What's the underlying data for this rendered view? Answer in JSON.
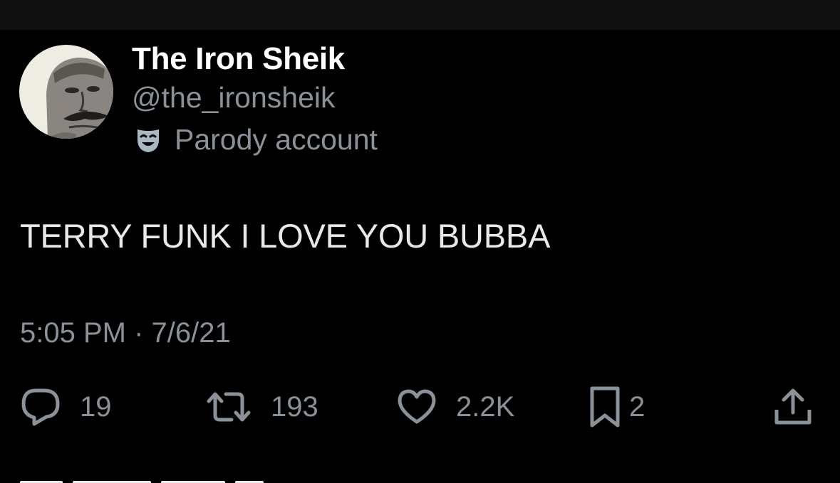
{
  "tweet": {
    "author": {
      "display_name": "The Iron Sheik",
      "handle": "@the_ironsheik",
      "label": "Parody account",
      "label_icon": "theater-mask-icon"
    },
    "text": "TERRY FUNK I LOVE YOU BUBBA",
    "timestamp": "5:05 PM · 7/6/21",
    "actions": {
      "replies": "19",
      "reposts": "193",
      "likes": "2.2K",
      "bookmarks": "2",
      "reply_icon": "reply-icon",
      "repost_icon": "repost-icon",
      "like_icon": "heart-icon",
      "bookmark_icon": "bookmark-icon",
      "share_icon": "share-icon"
    }
  },
  "colors": {
    "background": "#000000",
    "top_bar": "#0f0f10",
    "primary_text": "#e7e9ea",
    "secondary_text": "#8b9198",
    "mask_icon": "#aab8c2"
  }
}
